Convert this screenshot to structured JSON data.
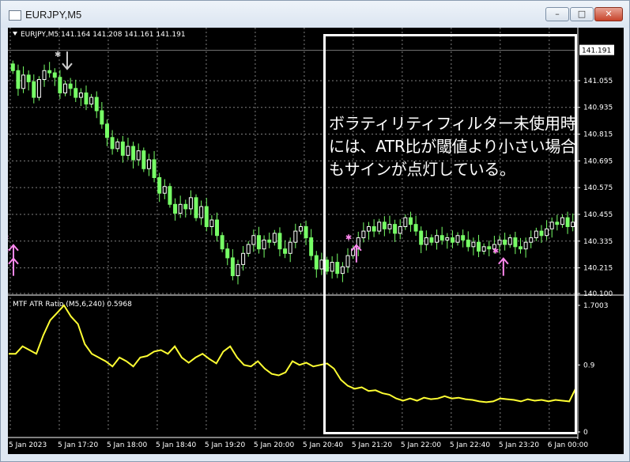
{
  "window": {
    "title": "EURJPY,M5",
    "minimize_symbol": "–",
    "maximize_symbol": "□",
    "close_symbol": "✕"
  },
  "colors": {
    "background": "#000000",
    "grid": "#7f7f7f",
    "candle_bull": "#ffffff",
    "candle_bear": "#77ff66",
    "atr_line": "#ffff33",
    "signal_arrow": "#ff88ee",
    "sell_arrow": "#cccccc",
    "annotation_border": "#ffffff"
  },
  "annotation": {
    "text": "ボラティリティフィルター未使用時には、ATR比が閾値より小さい場合もサインが点灯している。"
  },
  "chart_data": [
    {
      "type": "candlestick",
      "title": "EURJPY,M5  141.164 141.208 141.161 141.191",
      "current_price_label": "141.191",
      "ylim": [
        140.1,
        141.25
      ],
      "y_ticks": [
        "141.055",
        "140.935",
        "140.815",
        "140.695",
        "140.575",
        "140.455",
        "140.335",
        "140.215",
        "140.100"
      ],
      "x_ticks": [
        "5 Jan 2023",
        "5 Jan 17:20",
        "5 Jan 18:00",
        "5 Jan 18:40",
        "5 Jan 19:20",
        "5 Jan 20:00",
        "5 Jan 20:40",
        "5 Jan 21:20",
        "5 Jan 22:00",
        "5 Jan 22:40",
        "5 Jan 23:20",
        "6 Jan 00:00"
      ],
      "closes": [
        141.1,
        141.02,
        141.08,
        141.05,
        140.98,
        141.06,
        141.1,
        141.09,
        141.07,
        141.0,
        141.04,
        141.02,
        140.98,
        141.0,
        140.95,
        140.98,
        140.92,
        140.86,
        140.8,
        140.75,
        140.78,
        140.72,
        140.76,
        140.7,
        140.74,
        140.66,
        140.7,
        140.62,
        140.55,
        140.58,
        140.5,
        140.46,
        140.5,
        140.48,
        140.53,
        140.44,
        140.49,
        140.4,
        140.43,
        140.36,
        140.3,
        140.26,
        140.18,
        140.23,
        140.28,
        140.32,
        140.36,
        140.3,
        140.34,
        140.33,
        140.37,
        140.3,
        140.28,
        140.33,
        140.38,
        140.4,
        140.35,
        140.27,
        140.21,
        140.25,
        140.2,
        140.24,
        140.19,
        140.22,
        140.27,
        140.3,
        140.35,
        140.38,
        140.4,
        140.38,
        140.42,
        140.39,
        140.41,
        140.37,
        140.4,
        140.44,
        140.41,
        140.38,
        140.32,
        140.35,
        140.33,
        140.36,
        140.34,
        140.35,
        140.33,
        140.36,
        140.34,
        140.31,
        140.33,
        140.29,
        140.31,
        140.3,
        140.32,
        140.34,
        140.32,
        140.35,
        140.31,
        140.3,
        140.33,
        140.35,
        140.38,
        140.36,
        140.39,
        140.42,
        140.41,
        140.44,
        140.4,
        140.42
      ],
      "sell_signals": [
        {
          "time": "5 Jan 17:20",
          "price": 141.15
        }
      ],
      "buy_signals": [
        {
          "time": "5 Jan 21:00",
          "price": 140.36
        },
        {
          "time": "5 Jan 21:20",
          "price": 140.36
        },
        {
          "time": "5 Jan 23:00",
          "price": 140.3
        },
        {
          "time": "5 Jan 23:20",
          "price": 140.3
        }
      ]
    },
    {
      "type": "line",
      "title": "MTF ATR Ratio (M5,6,240) 0.5968",
      "y_ticks": [
        "1.7003",
        "0.9",
        "0"
      ],
      "ylim": [
        0,
        1.7003
      ],
      "x": [
        "5 Jan 2023",
        "5 Jan 17:20",
        "5 Jan 18:00",
        "5 Jan 18:40",
        "5 Jan 19:20",
        "5 Jan 20:00",
        "5 Jan 20:40",
        "5 Jan 21:20",
        "5 Jan 22:00",
        "5 Jan 22:40",
        "5 Jan 23:20",
        "6 Jan 00:00"
      ],
      "values": [
        1.05,
        1.05,
        1.15,
        1.1,
        1.05,
        1.3,
        1.5,
        1.6,
        1.7,
        1.55,
        1.45,
        1.18,
        1.05,
        1.0,
        0.95,
        0.88,
        1.0,
        0.95,
        0.88,
        1.0,
        1.02,
        1.08,
        1.1,
        1.05,
        1.15,
        1.0,
        0.93,
        1.0,
        1.05,
        0.98,
        0.92,
        1.08,
        1.15,
        1.0,
        0.9,
        0.88,
        0.95,
        0.85,
        0.78,
        0.76,
        0.8,
        0.95,
        0.9,
        0.93,
        0.88,
        0.9,
        0.92,
        0.85,
        0.7,
        0.62,
        0.58,
        0.6,
        0.55,
        0.56,
        0.52,
        0.5,
        0.45,
        0.42,
        0.45,
        0.42,
        0.46,
        0.44,
        0.45,
        0.48,
        0.45,
        0.46,
        0.44,
        0.43,
        0.41,
        0.4,
        0.41,
        0.45,
        0.44,
        0.43,
        0.41,
        0.44,
        0.42,
        0.43,
        0.41,
        0.43,
        0.42,
        0.41,
        0.6
      ],
      "series_color": "#ffff33"
    }
  ]
}
